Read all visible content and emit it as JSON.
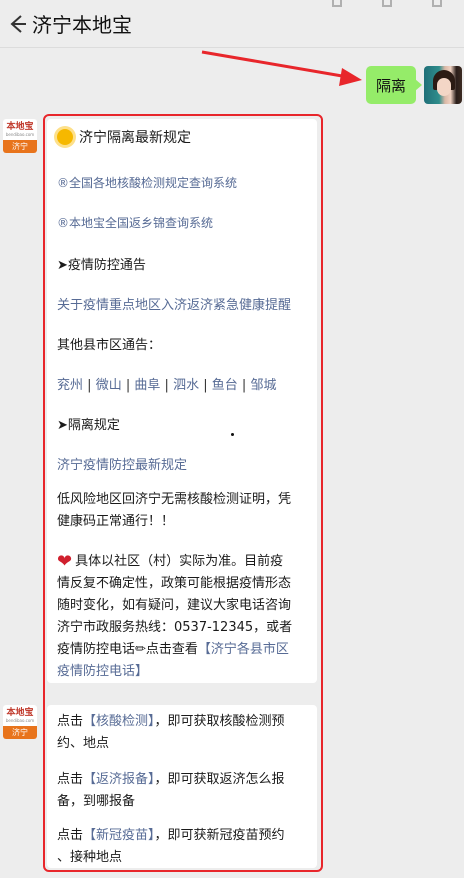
{
  "header": {
    "title": "济宁本地宝"
  },
  "my_message": {
    "text": "隔离"
  },
  "bot": {
    "brand": "本地宝",
    "domain": "bendibao.com",
    "city": "济宁"
  },
  "card1": {
    "heading": "济宁隔离最新规定",
    "link1": "®全国各地核酸检测规定查询系统",
    "link2": "®本地宝全国返乡锦查询系统",
    "section1": "➤疫情防控通告",
    "notice_link": "关于疫情重点地区入济返济紧急健康提醒",
    "other_counties": "其他县市区通告：",
    "counties": [
      "兖州",
      "微山",
      "曲阜",
      "泗水",
      "鱼台",
      "邹城"
    ],
    "county_sep": "|",
    "section2": "➤隔离规定",
    "rules_link": "济宁疫情防控最新规定",
    "low_risk_line1": "低风险地区回济宁无需核酸检测证明，凭",
    "low_risk_line2": "健康码正常通行！！",
    "note_line1": "具体以社区（村）实际为准。目前疫",
    "note_line2": "情反复不确定性，政策可能根据疫情形态",
    "note_line3": "随时变化，如有疑问，建议大家电话咨询",
    "note_line4": "济宁市政服务热线：0537-12345，或者",
    "note_line5_text": "疫情防控电话✏点击查看",
    "note_line5_link": "【济宁各县市区",
    "note_line6_link": "疫情防控电话】"
  },
  "card2": {
    "item1_pre": "点击",
    "item1_link": "【核酸检测】",
    "item1_post": "，即可获取核酸检测预",
    "item1_line2": "约、地点",
    "item2_pre": "点击",
    "item2_link": "【返济报备】",
    "item2_post": "，即可获取返济怎么报",
    "item2_line2": "备，到哪报备",
    "item3_pre": "点击",
    "item3_link": "【新冠疫苗】",
    "item3_post": "，即可获新冠疫苗预约",
    "item3_line2": "、接种地点"
  },
  "colors": {
    "bubble": "#95ec69",
    "link": "#576b95",
    "highlight": "#e8262b",
    "background": "#ededed"
  }
}
